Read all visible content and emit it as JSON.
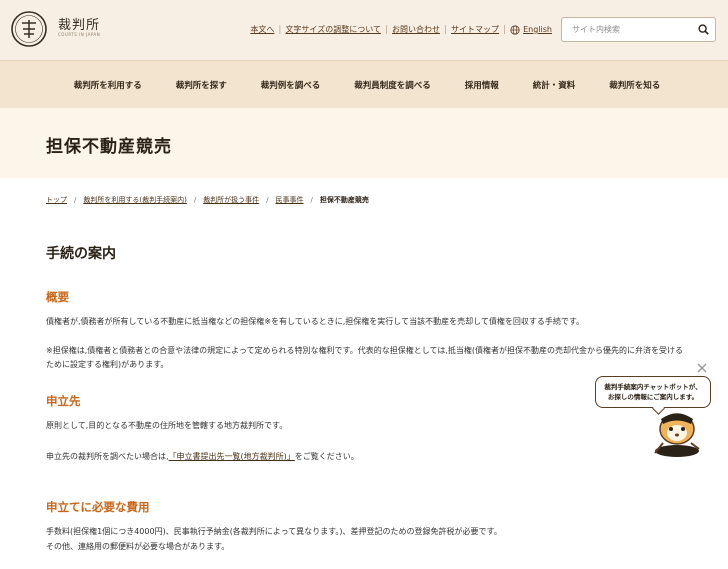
{
  "header": {
    "logo_name": "裁判所",
    "logo_sub": "COURTS IN JAPAN",
    "util_links": [
      "本文へ",
      "文字サイズの調整について",
      "お問い合わせ",
      "サイトマップ",
      "English"
    ],
    "search": {
      "placeholder": "サイト内検索"
    }
  },
  "nav": {
    "items": [
      "裁判所を利用する",
      "裁判所を探す",
      "裁判例を調べる",
      "裁判員制度を調べる",
      "採用情報",
      "統計・資料",
      "裁判所を知る"
    ]
  },
  "page": {
    "title": "担保不動産競売"
  },
  "breadcrumb": {
    "items": [
      "トップ",
      "裁判所を利用する(裁判手続案内)",
      "裁判所が扱う事件",
      "民事事件"
    ],
    "current": "担保不動産競売"
  },
  "content": {
    "heading": "手続の案内",
    "sections": [
      {
        "title": "概要",
        "paragraphs": [
          "債権者が,債務者が所有している不動産に抵当権などの担保権※を有しているときに,担保権を実行して当該不動産を売却して債権を回収する手続です。",
          "※担保権は,債権者と債務者との合意や法律の規定によって定められる特別な権利です。代表的な担保権としては,抵当権(債権者が担保不動産の売却代金から優先的に弁済を受けるために設定する権利)があります。"
        ]
      },
      {
        "title": "申立先",
        "paragraphs": [
          "原則として,目的となる不動産の住所地を管轄する地方裁判所です。"
        ],
        "link_prefix": "申立先の裁判所を調べたい場合は,",
        "link_text": "「申立書提出先一覧(地方裁判所)」",
        "link_suffix": "をご覧ください。"
      },
      {
        "title": "申立てに必要な費用",
        "paragraphs": [
          "手数料(担保権1個につき4000円)、民事執行予納金(各裁判所によって異なります。)、差押登記のための登録免許税が必要です。",
          "その他、連絡用の郵便料が必要な場合があります。"
        ]
      }
    ]
  },
  "chatbot": {
    "bubble_line1": "裁判手続案内チャットボットが、",
    "bubble_line2": "お探しの情報にご案内します。"
  },
  "colors": {
    "accent": "#c9661a",
    "header_bg": "#f7efe4",
    "nav_bg": "#f2e4cf",
    "title_bg": "#fcf5e9"
  },
  "icons": [
    "logo-emblem-icon",
    "globe-icon",
    "search-icon",
    "close-icon",
    "mascot-icon"
  ]
}
